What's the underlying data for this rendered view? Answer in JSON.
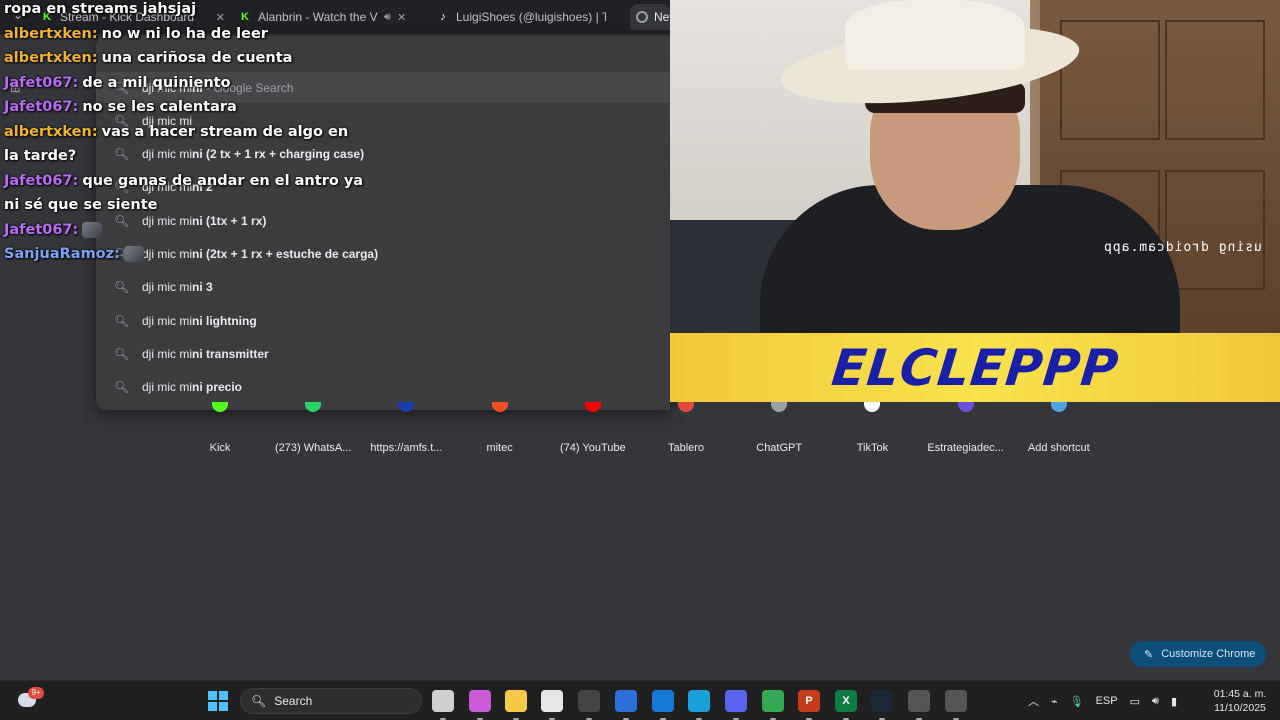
{
  "browser": {
    "tabs": [
      {
        "label": "Stream - Kick Dashboard",
        "favicon": "kick-icon",
        "color": "#53fc18"
      },
      {
        "label": "Alanbrin - Watch the VOD o",
        "favicon": "kick-icon",
        "color": "#53fc18"
      },
      {
        "label": "LuigiShoes (@luigishoes) | TikTo",
        "favicon": "tiktok-icon",
        "color": "#ffffff"
      },
      {
        "label": "New",
        "favicon": "chrome-icon",
        "color": "#9aa0a6"
      }
    ],
    "omnibox": {
      "typed_prefix": "dji mic mi",
      "typed_rest": "ni",
      "hint": " - Google Search"
    },
    "suggestions": [
      {
        "prefix": "dji mic mi",
        "rest": ""
      },
      {
        "prefix": "dji mic mi",
        "rest": "ni (2 tx + 1 rx + charging case)"
      },
      {
        "prefix": "dji mic mi",
        "rest": "ni 2"
      },
      {
        "prefix": "dji mic mi",
        "rest": "ni (1tx + 1 rx)"
      },
      {
        "prefix": "dji mic mi",
        "rest": "ni (2tx + 1 rx + estuche de carga)"
      },
      {
        "prefix": "dji mic mi",
        "rest": "ni 3"
      },
      {
        "prefix": "dji mic mi",
        "rest": "ni lightning"
      },
      {
        "prefix": "dji mic mi",
        "rest": "ni transmitter"
      },
      {
        "prefix": "dji mic mi",
        "rest": "ni precio"
      }
    ],
    "shortcuts": [
      {
        "label": "Kick",
        "color": "#53fc18"
      },
      {
        "label": "(273) WhatsA...",
        "color": "#25d366"
      },
      {
        "label": "https://amfs.t...",
        "color": "#1a3ea8"
      },
      {
        "label": "mitec",
        "color": "#f25022"
      },
      {
        "label": "(74) YouTube",
        "color": "#ff0000"
      },
      {
        "label": "Tablero",
        "color": "#e04b3c"
      },
      {
        "label": "ChatGPT",
        "color": "#9aa0a6"
      },
      {
        "label": "TikTok",
        "color": "#ffffff"
      },
      {
        "label": "Estrategiadec...",
        "color": "#6b4fd8"
      },
      {
        "label": "Add shortcut",
        "color": "#4fa3e0"
      }
    ],
    "customize_label": "Customize Chrome"
  },
  "chat": [
    {
      "user": "",
      "text": "ropa en streams jahsjaj",
      "user_class": "u-albert"
    },
    {
      "user": "albertxken:",
      "text": "no w ni lo ha de leer",
      "user_class": "u-albert"
    },
    {
      "user": "albertxken:",
      "text": "una cariñosa de cuenta",
      "user_class": "u-albert"
    },
    {
      "user": "Jafet067:",
      "text": "de a mil quiniento",
      "user_class": "u-jafet"
    },
    {
      "user": "Jafet067:",
      "text": "no se les calentara",
      "user_class": "u-jafet"
    },
    {
      "user": "albertxken:",
      "text": "vas a hacer stream de algo en la tarde?",
      "user_class": "u-albert"
    },
    {
      "user": "Jafet067:",
      "text": "que ganas de andar en el antro ya ni sé que se siente",
      "user_class": "u-jafet"
    },
    {
      "user": "Jafet067:",
      "text": "",
      "user_class": "u-jafet",
      "emote": true
    },
    {
      "user": "SanjuaRamoz:",
      "text": "",
      "user_class": "u-sanjua",
      "emote": true
    }
  ],
  "stream": {
    "watermark": "using droidcam.app",
    "banner": "ELCLEPPP"
  },
  "taskbar": {
    "weather_badge": "9+",
    "search_label": "Search",
    "apps": [
      {
        "name": "task-view-icon",
        "color": "#cfcfcf",
        "glyph": ""
      },
      {
        "name": "copilot-icon",
        "color": "#c85bd6",
        "glyph": ""
      },
      {
        "name": "file-explorer-icon",
        "color": "#f7c948",
        "glyph": ""
      },
      {
        "name": "microsoft-store-icon",
        "color": "#e8e8e8",
        "glyph": ""
      },
      {
        "name": "obs-icon",
        "color": "#444",
        "glyph": ""
      },
      {
        "name": "affinity-icon",
        "color": "#2d6fd8",
        "glyph": ""
      },
      {
        "name": "outlook-icon",
        "color": "#1478d4",
        "glyph": ""
      },
      {
        "name": "edge-icon",
        "color": "#1aa0d8",
        "glyph": ""
      },
      {
        "name": "discord-icon",
        "color": "#5865f2",
        "glyph": ""
      },
      {
        "name": "chrome-icon",
        "color": "#34a853",
        "glyph": ""
      },
      {
        "name": "powerpoint-icon",
        "color": "#c43e1c",
        "glyph": "P"
      },
      {
        "name": "excel-icon",
        "color": "#107c41",
        "glyph": "X"
      },
      {
        "name": "steam-icon",
        "color": "#1b2838",
        "glyph": ""
      },
      {
        "name": "davinci-icon",
        "color": "#555",
        "glyph": ""
      },
      {
        "name": "maps-icon",
        "color": "#555",
        "glyph": ""
      }
    ],
    "language": "ESP",
    "time": "01:45 a. m.",
    "date": "11/10/2025"
  }
}
